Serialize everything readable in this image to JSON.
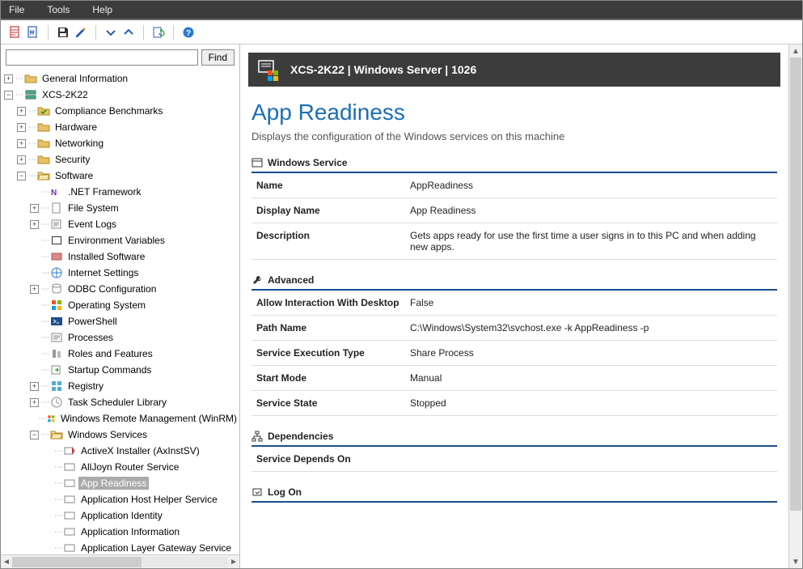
{
  "menu": {
    "file": "File",
    "tools": "Tools",
    "help": "Help"
  },
  "find": {
    "button": "Find",
    "value": ""
  },
  "tree": {
    "root1": "General Information",
    "root2": "XCS-2K22",
    "n_compliance": "Compliance Benchmarks",
    "n_hardware": "Hardware",
    "n_networking": "Networking",
    "n_security": "Security",
    "n_software": "Software",
    "s_net": ".NET Framework",
    "s_fs": "File System",
    "s_evt": "Event Logs",
    "s_env": "Environment Variables",
    "s_inst": "Installed Software",
    "s_inet": "Internet Settings",
    "s_odbc": "ODBC Configuration",
    "s_os": "Operating System",
    "s_ps": "PowerShell",
    "s_proc": "Processes",
    "s_roles": "Roles and Features",
    "s_startup": "Startup Commands",
    "s_reg": "Registry",
    "s_task": "Task Scheduler Library",
    "s_wrm": "Windows Remote Management (WinRM)",
    "s_svc": "Windows Services",
    "svc0": "ActiveX Installer (AxInstSV)",
    "svc1": "AllJoyn Router Service",
    "svc2": "App Readiness",
    "svc3": "Application Host Helper Service",
    "svc4": "Application Identity",
    "svc5": "Application Information",
    "svc6": "Application Layer Gateway Service"
  },
  "header": {
    "title": "XCS-2K22 | Windows Server | 1026"
  },
  "detail": {
    "title": "App Readiness",
    "subtitle": "Displays the configuration of the Windows services on this machine",
    "sec1": "Windows Service",
    "sec2": "Advanced",
    "sec3": "Dependencies",
    "sec4": "Log On",
    "k_name": "Name",
    "v_name": "AppReadiness",
    "k_disp": "Display Name",
    "v_disp": "App Readiness",
    "k_desc": "Description",
    "v_desc": "Gets apps ready for use the first time a user signs in to this PC and when adding new apps.",
    "k_allow": "Allow Interaction With Desktop",
    "v_allow": "False",
    "k_path": "Path Name",
    "v_path": "C:\\Windows\\System32\\svchost.exe -k AppReadiness -p",
    "k_exec": "Service Execution Type",
    "v_exec": "Share Process",
    "k_start": "Start Mode",
    "v_start": "Manual",
    "k_state": "Service State",
    "v_state": "Stopped",
    "k_dep": "Service Depends On"
  }
}
